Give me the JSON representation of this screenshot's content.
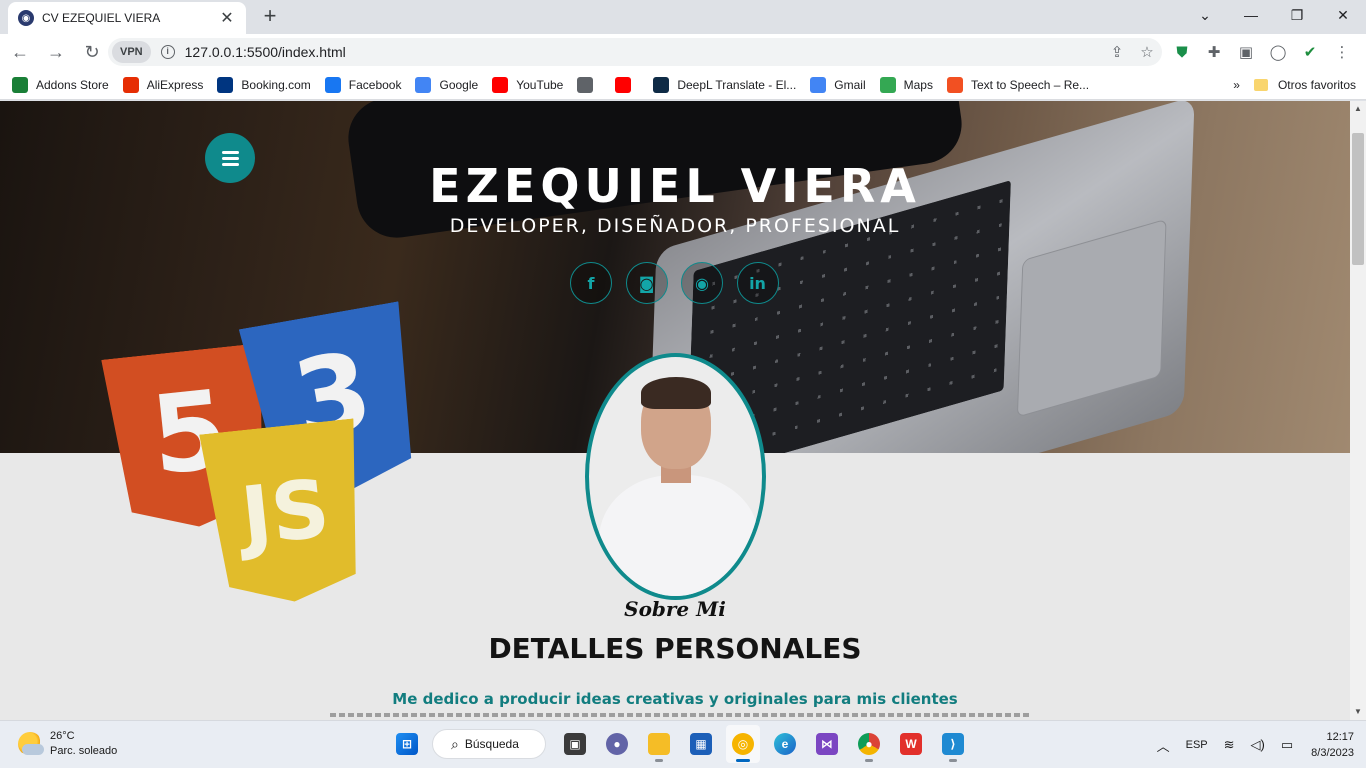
{
  "browser": {
    "tab_title": "CV EZEQUIEL VIERA",
    "new_tab_symbol": "+",
    "window_controls": [
      "⌄",
      "—",
      "❐",
      "✕"
    ],
    "vpn_label": "VPN",
    "url": "127.0.0.1:5500/index.html"
  },
  "bookmarks": [
    {
      "label": "Addons Store",
      "icon": "addons-store-icon",
      "color": "#1a7f37"
    },
    {
      "label": "AliExpress",
      "icon": "aliexpress-icon",
      "color": "#e62e04"
    },
    {
      "label": "Booking.com",
      "icon": "booking-icon",
      "color": "#003580"
    },
    {
      "label": "Facebook",
      "icon": "facebook-icon",
      "color": "#1877f2"
    },
    {
      "label": "Google",
      "icon": "google-icon",
      "color": "#4285f4"
    },
    {
      "label": "YouTube",
      "icon": "youtube-icon",
      "color": "#ff0000"
    },
    {
      "label": "",
      "icon": "globe-icon",
      "color": "#5f6368"
    },
    {
      "label": "",
      "icon": "youtube-icon",
      "color": "#ff0000"
    },
    {
      "label": "DeepL Translate - El...",
      "icon": "deepl-icon",
      "color": "#0f2b46"
    },
    {
      "label": "Gmail",
      "icon": "google-icon",
      "color": "#4285f4"
    },
    {
      "label": "Maps",
      "icon": "maps-icon",
      "color": "#34a853"
    },
    {
      "label": "Text to Speech – Re...",
      "icon": "text-to-speech-icon",
      "color": "#f25022"
    }
  ],
  "bookmarks_overflow": "»",
  "other_bookmarks": "Otros favoritos",
  "page": {
    "name": "EZEQUIEL VIERA",
    "subtitle": "DEVELOPER, DISEÑADOR, PROFESIONAL",
    "social": [
      {
        "icon": "facebook-icon",
        "glyph": "f"
      },
      {
        "icon": "instagram-icon",
        "glyph": "◙"
      },
      {
        "icon": "github-icon",
        "glyph": "◉"
      },
      {
        "icon": "linkedin-icon",
        "glyph": "in"
      }
    ],
    "logos": {
      "html": "5",
      "css": "3",
      "js": "JS"
    },
    "about_script": "Sobre Mi",
    "about_title": "DETALLES PERSONALES",
    "about_lead": "Me dedico a producir ideas creativas y originales para mis clientes",
    "accent_color": "#0f8a8c"
  },
  "taskbar": {
    "temperature": "26°C",
    "weather": "Parc. soleado",
    "search_label": "Búsqueda",
    "language": "ESP",
    "time": "12:17",
    "date": "8/3/2023"
  }
}
